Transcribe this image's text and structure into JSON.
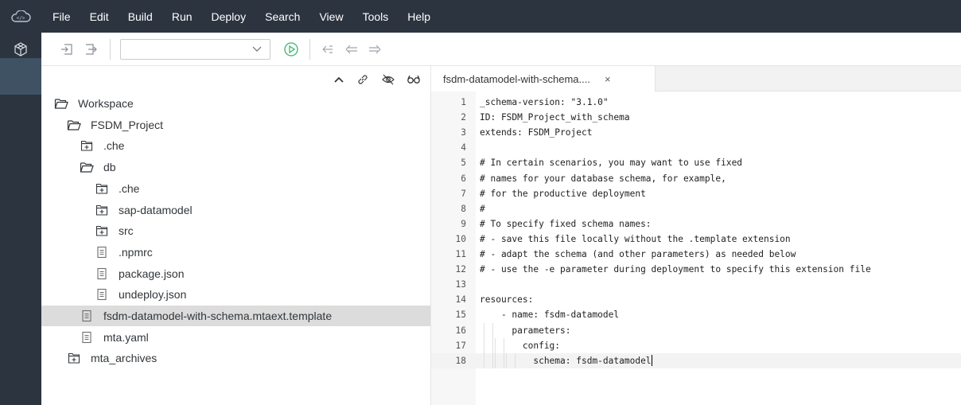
{
  "menubar": {
    "items": [
      "File",
      "Edit",
      "Build",
      "Run",
      "Deploy",
      "Search",
      "View",
      "Tools",
      "Help"
    ]
  },
  "activitybar": {
    "items": [
      {
        "name": "development",
        "icon": "code-icon",
        "label": "</>"
      },
      {
        "name": "database-explorer",
        "icon": "cube-icon"
      },
      {
        "name": "preferences",
        "icon": "gear-icon"
      }
    ]
  },
  "toolbar": {
    "select_value": "",
    "icons": [
      "import-icon",
      "export-icon",
      "run-icon",
      "previous-change-icon",
      "back-icon",
      "forward-icon"
    ]
  },
  "explorer": {
    "header_icons": [
      "collapse-icon",
      "link-icon",
      "hide-icon",
      "show-hidden-icon"
    ],
    "tree": [
      {
        "label": "Workspace",
        "type": "folder-open",
        "level": 0
      },
      {
        "label": "FSDM_Project",
        "type": "folder-open",
        "level": 1
      },
      {
        "label": ".che",
        "type": "folder-closed",
        "level": 2
      },
      {
        "label": "db",
        "type": "folder-open",
        "level": 2
      },
      {
        "label": ".che",
        "type": "folder-closed",
        "level": 3
      },
      {
        "label": "sap-datamodel",
        "type": "folder-closed",
        "level": 3
      },
      {
        "label": "src",
        "type": "folder-closed",
        "level": 3
      },
      {
        "label": ".npmrc",
        "type": "file",
        "level": 3
      },
      {
        "label": "package.json",
        "type": "file",
        "level": 3
      },
      {
        "label": "undeploy.json",
        "type": "file",
        "level": 3
      },
      {
        "label": "fsdm-datamodel-with-schema.mtaext.template",
        "type": "file",
        "level": 2,
        "selected": true
      },
      {
        "label": "mta.yaml",
        "type": "file",
        "level": 2
      },
      {
        "label": "mta_archives",
        "type": "folder-closed",
        "level": 1
      }
    ]
  },
  "editor": {
    "tab": {
      "title": "fsdm-datamodel-with-schema....",
      "close": "×"
    },
    "active_line": 18,
    "lines": [
      "_schema-version: \"3.1.0\"",
      "ID: FSDM_Project_with_schema",
      "extends: FSDM_Project",
      "",
      "# In certain scenarios, you may want to use fixed",
      "# names for your database schema, for example,",
      "# for the productive deployment",
      "#",
      "# To specify fixed schema names:",
      "# - save this file locally without the .template extension",
      "# - adapt the schema (and other parameters) as needed below",
      "# - use the -e parameter during deployment to specify this extension file",
      "",
      "resources:",
      "    - name: fsdm-datamodel",
      "      parameters:",
      "        config:",
      "          schema: fsdm-datamodel"
    ]
  },
  "colors": {
    "shell": "#2c3440",
    "active_activity": "#3e5264",
    "selection": "#dcdcdc",
    "run_green": "#3cb371",
    "icon_gray": "#8a8f96"
  }
}
